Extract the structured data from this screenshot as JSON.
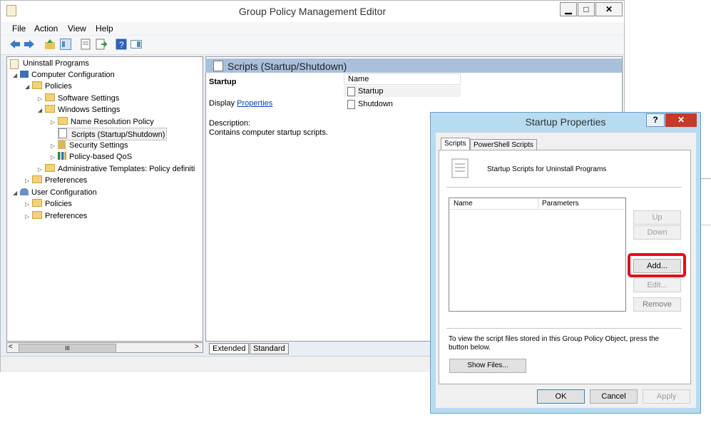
{
  "main_window": {
    "title": "Group Policy Management Editor",
    "minimize_label": "▁",
    "maximize_label": "□",
    "close_label": "✕"
  },
  "menubar": {
    "items": [
      "File",
      "Action",
      "View",
      "Help"
    ]
  },
  "tree": {
    "root": "Uninstall Programs",
    "computer_config": "Computer Configuration",
    "policies": "Policies",
    "software_settings": "Software Settings",
    "windows_settings": "Windows Settings",
    "name_resolution": "Name Resolution Policy",
    "scripts": "Scripts (Startup/Shutdown)",
    "security_settings": "Security Settings",
    "policy_qos": "Policy-based QoS",
    "admin_templates": "Administrative Templates: Policy definiti",
    "preferences1": "Preferences",
    "user_config": "User Configuration",
    "user_policies": "Policies",
    "preferences2": "Preferences",
    "scroll_thumb": "III"
  },
  "right_pane": {
    "header": "Scripts (Startup/Shutdown)",
    "section_title": "Startup",
    "display_label": "Display",
    "properties_link": "Properties",
    "description_label": "Description:",
    "description_text": "Contains computer startup scripts.",
    "col_name": "Name",
    "items": [
      "Startup",
      "Shutdown"
    ],
    "tabs": [
      "Extended",
      "Standard"
    ]
  },
  "dialog": {
    "title": "Startup Properties",
    "help_label": "?",
    "close_label": "✕",
    "tabs": [
      "Scripts",
      "PowerShell Scripts"
    ],
    "heading": "Startup Scripts for Uninstall Programs",
    "col_name": "Name",
    "col_params": "Parameters",
    "btn_up": "Up",
    "btn_down": "Down",
    "btn_add": "Add...",
    "btn_edit": "Edit...",
    "btn_remove": "Remove",
    "info_text": "To view the script files stored in this Group Policy Object, press the button below.",
    "btn_show_files": "Show Files...",
    "btn_ok": "OK",
    "btn_cancel": "Cancel",
    "btn_apply": "Apply"
  },
  "colors": {
    "highlight": "#e0101b",
    "link": "#0645ad",
    "header": "#a9c0dd"
  }
}
